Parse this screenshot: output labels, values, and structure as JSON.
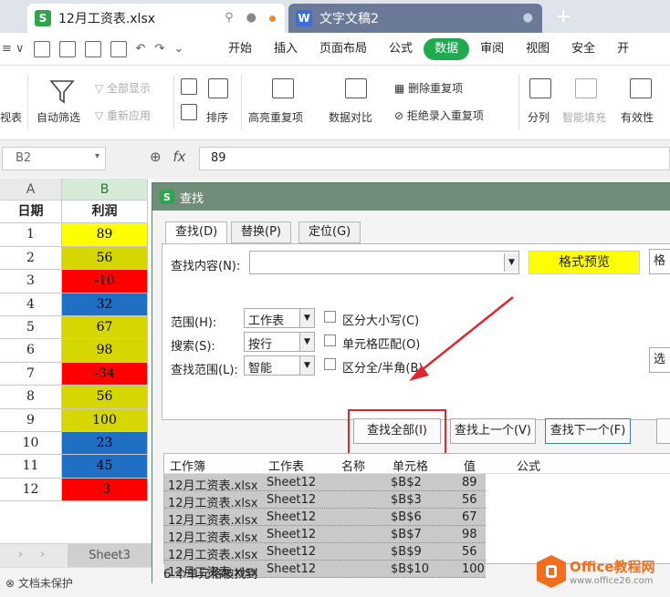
{
  "tabs": [
    {
      "label": "12月工资表.xlsx",
      "app": "S"
    },
    {
      "label": "文字文稿2",
      "app": "W"
    }
  ],
  "menu": {
    "items": [
      "开始",
      "插入",
      "页面布局",
      "公式",
      "数据",
      "审阅",
      "视图",
      "安全",
      "开"
    ],
    "active": "数据"
  },
  "ribbon": {
    "cut_label": "视表",
    "filter": "自动筛选",
    "show_all": "全部显示",
    "reapply": "重新应用",
    "sort": "排序",
    "highlight_dup": "高亮重复项",
    "compare": "数据对比",
    "remove_dup": "删除重复项",
    "reject_dup": "拒绝录入重复项",
    "split": "分列",
    "smart_fill": "智能填充",
    "validity": "有效性"
  },
  "formula_bar": {
    "name_box": "B2",
    "fx": "fx",
    "value": "89"
  },
  "sheet": {
    "col_a": "A",
    "col_b": "B",
    "header_a": "日期",
    "header_b": "利润",
    "rows": [
      {
        "a": "1",
        "b": "89",
        "color": "#ffff00",
        "text": "#000000"
      },
      {
        "a": "2",
        "b": "56",
        "color": "#d6d600",
        "text": "#000000"
      },
      {
        "a": "3",
        "b": "-10",
        "color": "#ff0000",
        "text": "#000000"
      },
      {
        "a": "4",
        "b": "32",
        "color": "#1f6fc5",
        "text": "#000000"
      },
      {
        "a": "5",
        "b": "67",
        "color": "#d6d600",
        "text": "#000000"
      },
      {
        "a": "6",
        "b": "98",
        "color": "#d6d600",
        "text": "#000000"
      },
      {
        "a": "7",
        "b": "-34",
        "color": "#ff0000",
        "text": "#000000"
      },
      {
        "a": "8",
        "b": "56",
        "color": "#d6d600",
        "text": "#000000"
      },
      {
        "a": "9",
        "b": "100",
        "color": "#d6d600",
        "text": "#000000"
      },
      {
        "a": "10",
        "b": "23",
        "color": "#1f6fc5",
        "text": "#000000"
      },
      {
        "a": "11",
        "b": "45",
        "color": "#1f6fc5",
        "text": "#000000"
      },
      {
        "a": "12",
        "b": "-3",
        "color": "#ff0000",
        "text": "#000000"
      }
    ],
    "sheet_tab": "Sheet3"
  },
  "status": "文档未保护",
  "dialog": {
    "title": "查找",
    "tabs": [
      "查找(D)",
      "替换(P)",
      "定位(G)"
    ],
    "find_label": "查找内容(N):",
    "format_preview": "格式预览",
    "format_btn": "格",
    "options_btn": "选",
    "scope_label": "范围(H):",
    "scope_value": "工作表",
    "search_label": "搜索(S):",
    "search_value": "按行",
    "lookin_label": "查找范围(L):",
    "lookin_value": "智能",
    "case": "区分大小写(C)",
    "match_cell": "单元格匹配(O)",
    "full_half": "区分全/半角(B)",
    "find_all": "查找全部(I)",
    "find_prev": "查找上一个(V)",
    "find_next": "查找下一个(F)",
    "result_headers": [
      "工作簿",
      "工作表",
      "名称",
      "单元格",
      "值",
      "公式"
    ],
    "results": [
      {
        "book": "12月工资表.xlsx",
        "sheet": "Sheet12",
        "cell": "$B$2",
        "value": "89"
      },
      {
        "book": "12月工资表.xlsx",
        "sheet": "Sheet12",
        "cell": "$B$3",
        "value": "56"
      },
      {
        "book": "12月工资表.xlsx",
        "sheet": "Sheet12",
        "cell": "$B$6",
        "value": "67"
      },
      {
        "book": "12月工资表.xlsx",
        "sheet": "Sheet12",
        "cell": "$B$7",
        "value": "98"
      },
      {
        "book": "12月工资表.xlsx",
        "sheet": "Sheet12",
        "cell": "$B$9",
        "value": "56"
      },
      {
        "book": "12月工资表.xlsx",
        "sheet": "Sheet12",
        "cell": "$B$10",
        "value": "100"
      }
    ],
    "found_text": "6 个单元格被找到"
  },
  "watermark": {
    "line1": "Office教程网",
    "line2": "www.office26.com"
  },
  "colors": {
    "accent": "#1faa4f",
    "highlight": "#e0262d"
  }
}
